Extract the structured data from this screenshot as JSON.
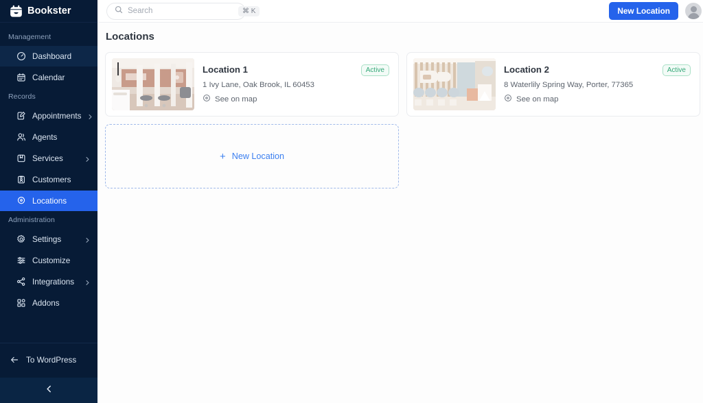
{
  "brand": {
    "name": "Bookster",
    "logo_icon": "calendar-smile-icon"
  },
  "sidebar": {
    "sections": [
      {
        "label": "Management",
        "items": [
          {
            "label": "Dashboard",
            "icon": "gauge-icon",
            "state": "hovered",
            "chevron": false
          },
          {
            "label": "Calendar",
            "icon": "calendar-icon",
            "state": "default",
            "chevron": false
          }
        ]
      },
      {
        "label": "Records",
        "items": [
          {
            "label": "Appointments",
            "icon": "edit-note-icon",
            "state": "default",
            "chevron": true
          },
          {
            "label": "Agents",
            "icon": "users-icon",
            "state": "default",
            "chevron": false
          },
          {
            "label": "Services",
            "icon": "archive-icon",
            "state": "default",
            "chevron": true
          },
          {
            "label": "Customers",
            "icon": "contact-card-icon",
            "state": "default",
            "chevron": false
          },
          {
            "label": "Locations",
            "icon": "map-pin-icon",
            "state": "active",
            "chevron": false
          }
        ]
      },
      {
        "label": "Administration",
        "items": [
          {
            "label": "Settings",
            "icon": "gear-icon",
            "state": "default",
            "chevron": true
          },
          {
            "label": "Customize",
            "icon": "sliders-icon",
            "state": "default",
            "chevron": false
          },
          {
            "label": "Integrations",
            "icon": "share-nodes-icon",
            "state": "default",
            "chevron": true
          },
          {
            "label": "Addons",
            "icon": "grid-plus-icon",
            "state": "default",
            "chevron": false
          }
        ]
      }
    ],
    "footer": {
      "label": "To WordPress",
      "icon": "arrow-left-icon"
    },
    "collapse": {
      "icon": "chevron-left-icon"
    },
    "accent_active": "#2563eb",
    "background": "#071b36"
  },
  "topbar": {
    "search": {
      "placeholder": "Search",
      "value": "",
      "icon": "search-icon",
      "shortcut": "⌘ K"
    },
    "new_location_button": "New Location",
    "avatar": "user-avatar"
  },
  "page": {
    "title": "Locations"
  },
  "locations": [
    {
      "title": "Location 1",
      "address": "1 Ivy Lane, Oak Brook, IL 60453",
      "status": "Active",
      "map_link": "See on map",
      "thumb": "salon-interior-beige"
    },
    {
      "title": "Location 2",
      "address": "8 Waterlily Spring Way, Porter, 77365",
      "status": "Active",
      "map_link": "See on map",
      "thumb": "nail-salon-cream"
    }
  ],
  "new_location_card": {
    "label": "New Location",
    "icon": "plus-icon"
  },
  "colors": {
    "primary": "#2563eb",
    "badge_green": "#34a878",
    "link_blue": "#3b7ff0"
  }
}
